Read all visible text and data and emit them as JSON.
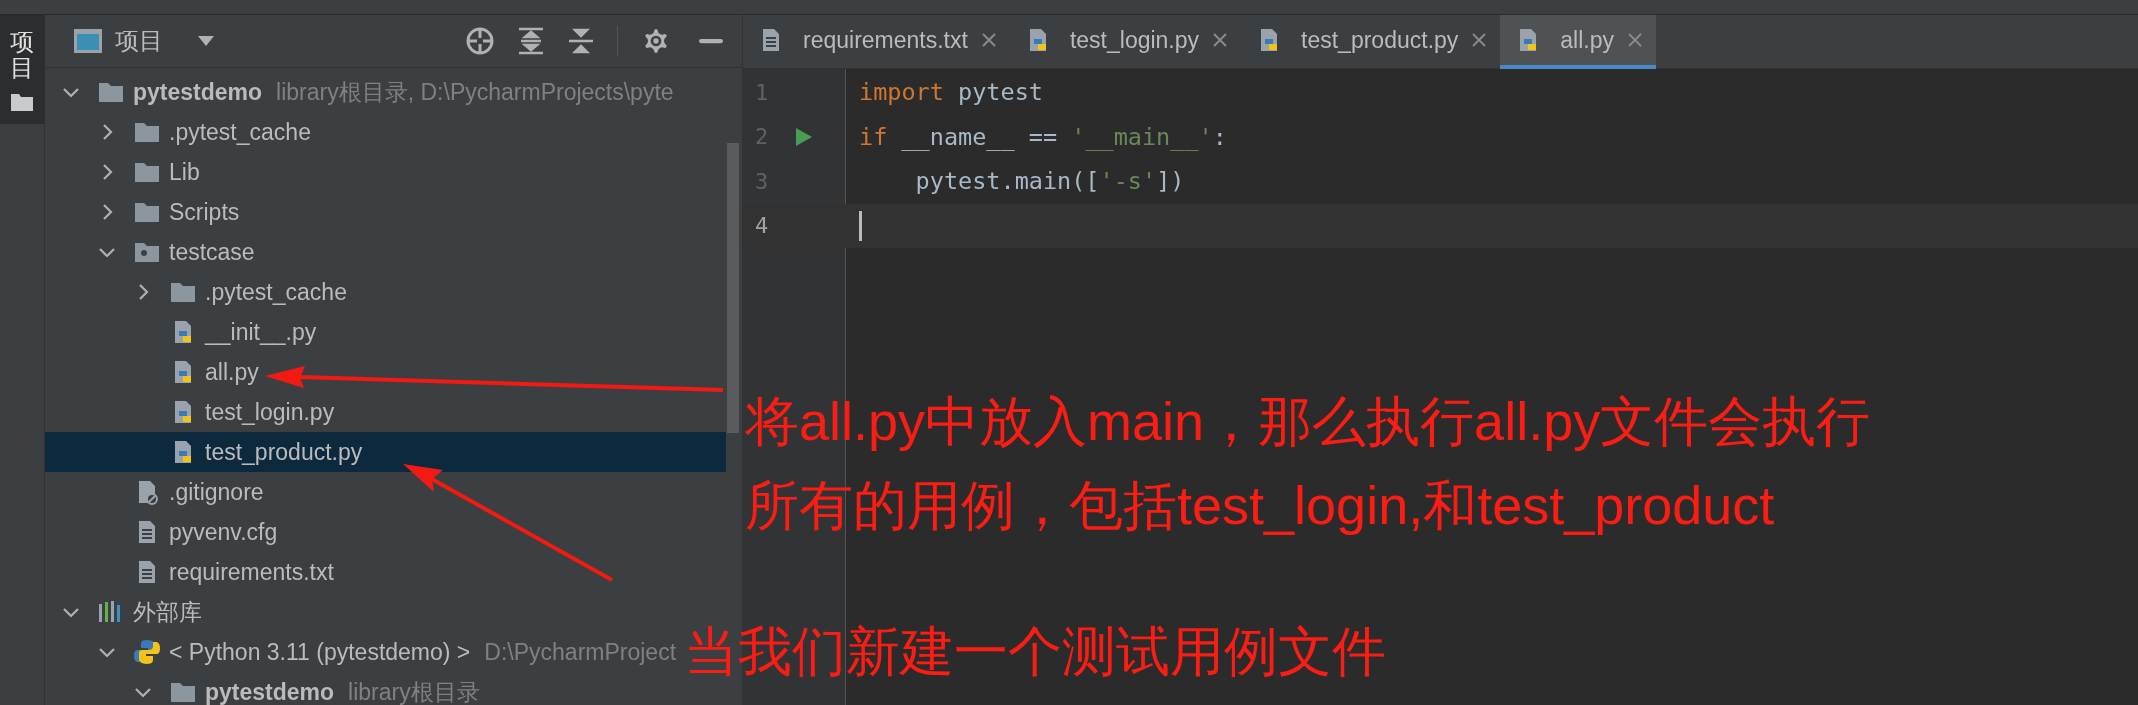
{
  "tool_strip": {
    "tab": {
      "label": "项目",
      "selected": true
    }
  },
  "project_panel": {
    "title": "项目",
    "tree": [
      {
        "kind": "folder",
        "name": "pytestdemo",
        "bold": true,
        "hint": "library根目录, D:\\PycharmProjects\\pyte",
        "expanded": true,
        "selected": false,
        "children": [
          {
            "kind": "folder",
            "name": ".pytest_cache",
            "expanded": false,
            "selected": false
          },
          {
            "kind": "folder",
            "name": "Lib",
            "expanded": false,
            "selected": false
          },
          {
            "kind": "folder",
            "name": "Scripts",
            "expanded": false,
            "selected": false
          },
          {
            "kind": "package",
            "name": "testcase",
            "expanded": true,
            "selected": false,
            "children": [
              {
                "kind": "folder",
                "name": ".pytest_cache",
                "expanded": false,
                "selected": false
              },
              {
                "kind": "python",
                "name": "__init__.py",
                "selected": false
              },
              {
                "kind": "python",
                "name": "all.py",
                "selected": false
              },
              {
                "kind": "python",
                "name": "test_login.py",
                "selected": false
              },
              {
                "kind": "python",
                "name": "test_product.py",
                "selected": true
              }
            ]
          },
          {
            "kind": "ignore",
            "name": ".gitignore",
            "selected": false
          },
          {
            "kind": "text",
            "name": "pyvenv.cfg",
            "selected": false
          },
          {
            "kind": "text",
            "name": "requirements.txt",
            "selected": false
          }
        ]
      },
      {
        "kind": "library",
        "name": "外部库",
        "expanded": true,
        "selected": false,
        "children": [
          {
            "kind": "sdk",
            "name": "< Python 3.11 (pytestdemo) >",
            "hint": "D:\\PycharmProject",
            "expanded": true,
            "selected": false,
            "children": [
              {
                "kind": "folder",
                "name": "pytestdemo",
                "bold": true,
                "hint": "library根目录",
                "expanded": true,
                "selected": false
              }
            ]
          }
        ]
      }
    ]
  },
  "editor": {
    "tabs": [
      {
        "kind": "text",
        "label": "requirements.txt",
        "selected": false
      },
      {
        "kind": "python",
        "label": "test_login.py",
        "selected": false
      },
      {
        "kind": "python",
        "label": "test_product.py",
        "selected": false
      },
      {
        "kind": "python",
        "label": "all.py",
        "selected": true
      }
    ],
    "lines": [
      {
        "number": "1",
        "run": false,
        "current": false,
        "tokens": [
          {
            "kind": "keyword",
            "text": "import"
          },
          {
            "kind": "plain",
            "text": " pytest"
          }
        ]
      },
      {
        "number": "2",
        "run": true,
        "current": false,
        "tokens": [
          {
            "kind": "keyword",
            "text": "if"
          },
          {
            "kind": "plain",
            "text": " __name__ == "
          },
          {
            "kind": "string",
            "text": "'__main__'"
          },
          {
            "kind": "plain",
            "text": ":"
          }
        ]
      },
      {
        "number": "3",
        "run": false,
        "current": false,
        "tokens": [
          {
            "kind": "plain",
            "text": "    pytest.main(["
          },
          {
            "kind": "string",
            "text": "'-s'"
          },
          {
            "kind": "plain",
            "text": "])"
          }
        ]
      },
      {
        "number": "4",
        "run": false,
        "current": true
      }
    ]
  },
  "annotations": [
    {
      "text": "将all.py中放入main，那么执行all.py文件会执行"
    },
    {
      "text": "所有的用例，包括test_login,和test_product"
    },
    {
      "text": "当我们新建一个测试用例文件"
    }
  ]
}
